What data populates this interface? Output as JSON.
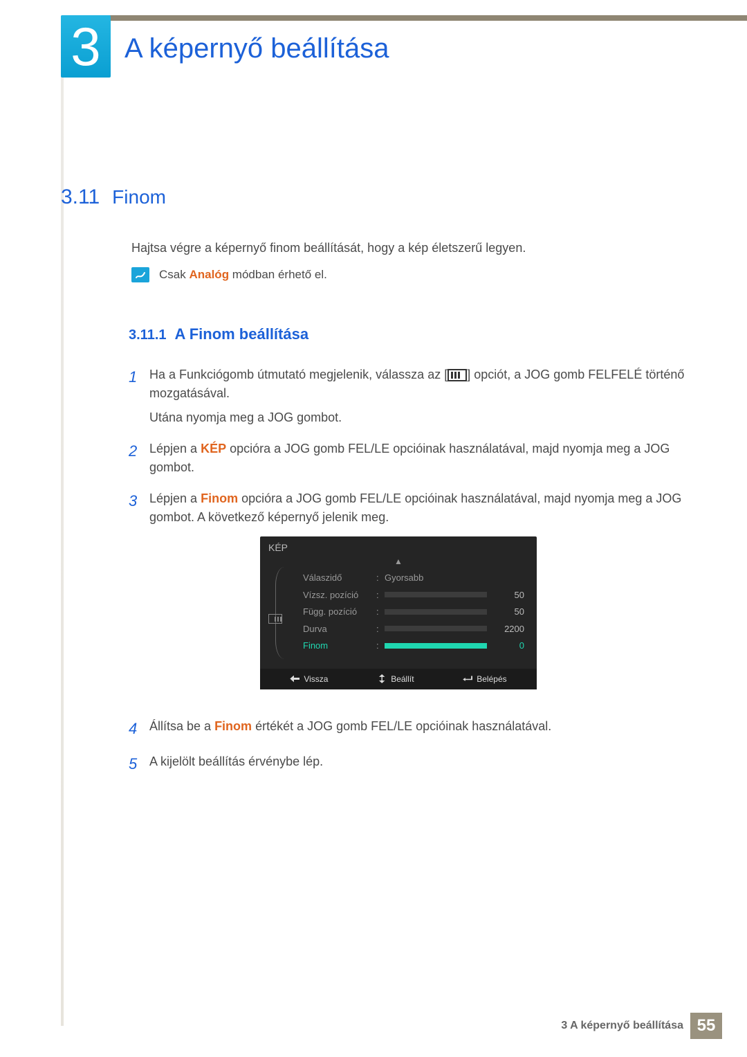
{
  "chapter": {
    "number": "3",
    "title": "A képernyő beállítása"
  },
  "section": {
    "number": "3.11",
    "title": "Finom"
  },
  "intro": "Hajtsa végre a képernyő finom beállítását, hogy a kép életszerű legyen.",
  "note": {
    "prefix": "Csak ",
    "highlight": "Analóg",
    "suffix": " módban érhető el."
  },
  "subsection": {
    "number": "3.11.1",
    "title": "A Finom beállítása"
  },
  "steps": {
    "s1": {
      "num": "1",
      "a": "Ha a Funkciógomb útmutató megjelenik, válassza az [",
      "b": "] opciót, a JOG gomb FELFELÉ történő mozgatásával.",
      "sub": "Utána nyomja meg a JOG gombot."
    },
    "s2": {
      "num": "2",
      "a": "Lépjen a ",
      "hl": "KÉP",
      "b": " opcióra a JOG gomb FEL/LE opcióinak használatával, majd nyomja meg a JOG gombot."
    },
    "s3": {
      "num": "3",
      "a": "Lépjen a ",
      "hl": "Finom",
      "b": " opcióra a JOG gomb FEL/LE opcióinak használatával, majd nyomja meg a JOG gombot. A következő képernyő jelenik meg."
    },
    "s4": {
      "num": "4",
      "a": "Állítsa be a ",
      "hl": "Finom",
      "b": " értékét a JOG gomb FEL/LE opcióinak használatával."
    },
    "s5": {
      "num": "5",
      "a": "A kijelölt beállítás érvénybe lép."
    }
  },
  "osd": {
    "title": "KÉP",
    "rows": [
      {
        "label": "Válaszidő",
        "value_text": "Gyorsabb"
      },
      {
        "label": "Vízsz. pozíció",
        "value": 50,
        "max": 100
      },
      {
        "label": "Függ. pozíció",
        "value": 50,
        "max": 100
      },
      {
        "label": "Durva",
        "value": 2200,
        "max": 3000
      },
      {
        "label": "Finom",
        "value": 0,
        "max": 100,
        "active": true
      }
    ],
    "footer": {
      "back": "Vissza",
      "adjust": "Beállít",
      "enter": "Belépés"
    }
  },
  "footer": {
    "chapter_label": "3 A képernyő beállítása",
    "page": "55"
  }
}
